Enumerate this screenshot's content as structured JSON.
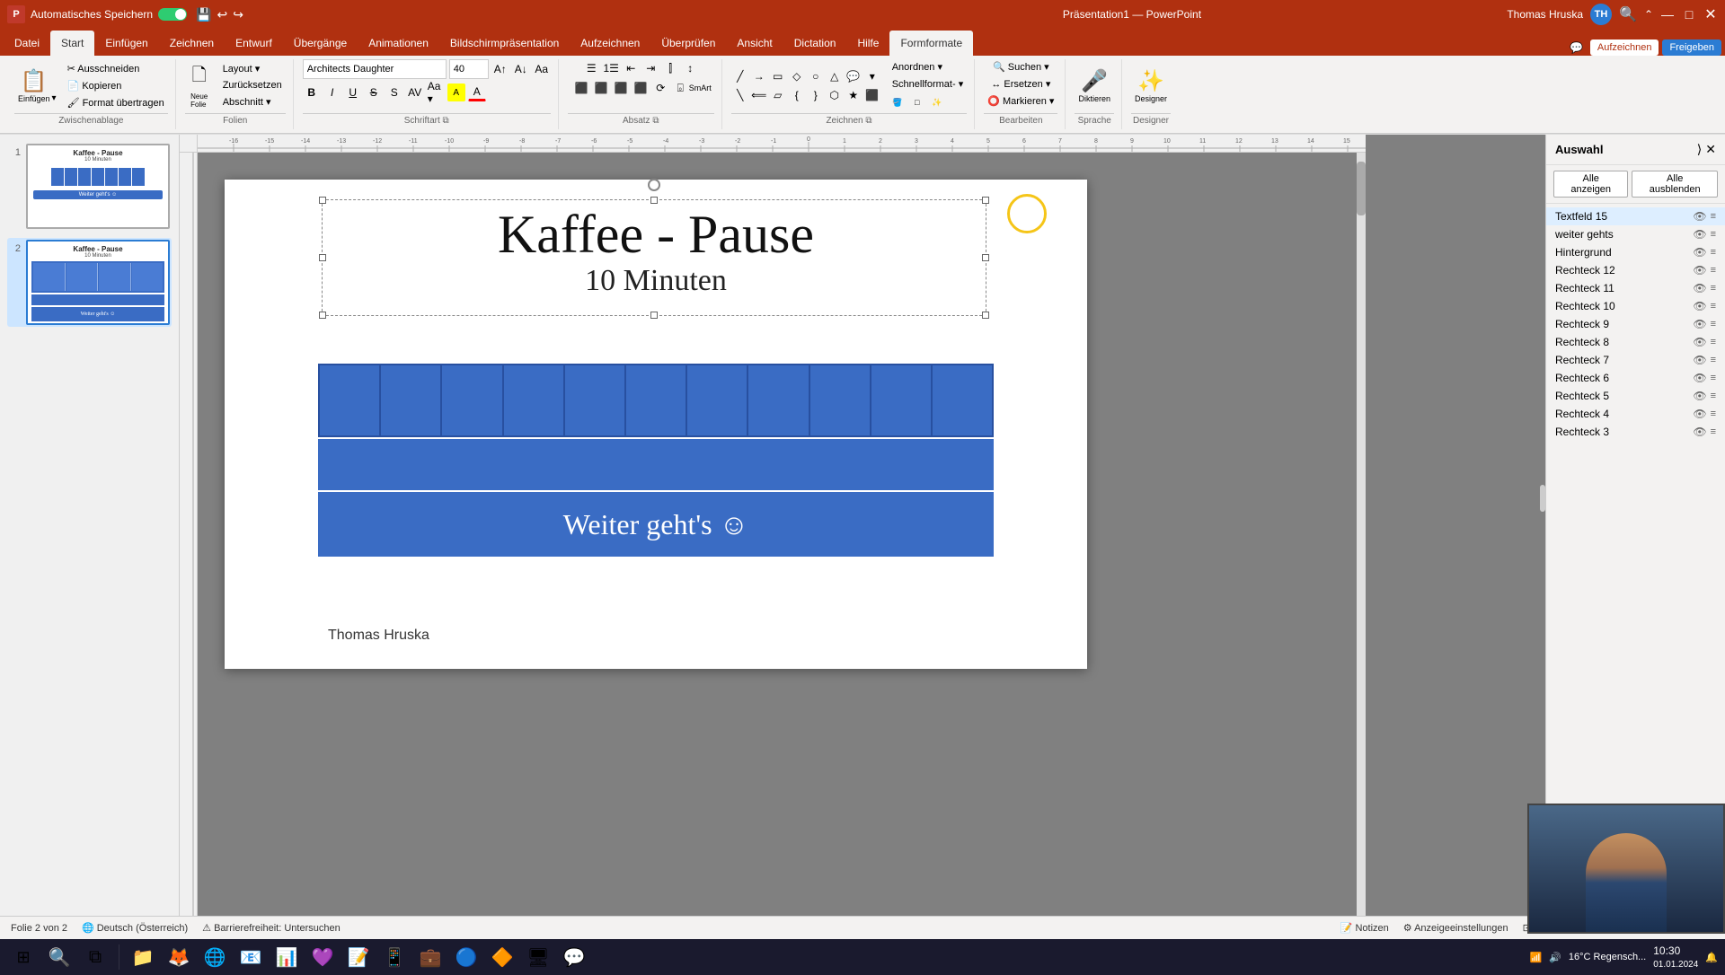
{
  "titleBar": {
    "autosave": "Automatisches Speichern",
    "filename": "Präsentation1",
    "app": "PowerPoint",
    "user": "Thomas Hruska",
    "initials": "TH"
  },
  "ribbonTabs": [
    {
      "label": "Datei",
      "active": false
    },
    {
      "label": "Start",
      "active": true
    },
    {
      "label": "Einfügen",
      "active": false
    },
    {
      "label": "Zeichnen",
      "active": false
    },
    {
      "label": "Entwurf",
      "active": false
    },
    {
      "label": "Übergänge",
      "active": false
    },
    {
      "label": "Animationen",
      "active": false
    },
    {
      "label": "Bildschirmpräsentation",
      "active": false
    },
    {
      "label": "Aufzeichnen",
      "active": false
    },
    {
      "label": "Überprüfen",
      "active": false
    },
    {
      "label": "Ansicht",
      "active": false
    },
    {
      "label": "Dictation",
      "active": false
    },
    {
      "label": "Hilfe",
      "active": false
    },
    {
      "label": "Formformate",
      "active": true,
      "highlighted": true
    }
  ],
  "toolbar": {
    "fontName": "Architects Daughter",
    "fontSize": "40",
    "groups": {
      "clipboard": "Zwischenablage",
      "slides": "Folien",
      "font": "Schriftart",
      "paragraph": "Absatz",
      "drawing": "Zeichnen",
      "editing": "Bearbeiten",
      "voice": "Sprache",
      "designer": "Designer"
    },
    "buttons": {
      "ausschneiden": "Ausschneiden",
      "kopieren": "Kopieren",
      "einfuegen": "Einfügen",
      "zurücksetzen": "Zurücksetzen",
      "formatPinsel": "Format übertragen",
      "neuefolie": "Neue Folie",
      "layout": "Layout",
      "abschnitt": "Abschnitt",
      "diktieren": "Diktieren",
      "designer": "Designer",
      "anordnen": "Anordnen",
      "schnellformatvorlagen": "Schnellformat-vorlagen",
      "suchen": "Suchen",
      "ersetzen": "Ersetzen",
      "markieren": "Markieren",
      "formeffekt": "Formeffekt",
      "formkontur": "Formkontur",
      "formfuellung": "Füleffekt"
    }
  },
  "slides": [
    {
      "num": 1,
      "title": "Kaffee - Pause",
      "subtitle": "10 Minuten",
      "active": false
    },
    {
      "num": 2,
      "title": "Kaffee - Pause",
      "subtitle": "10 Minuten",
      "active": true
    }
  ],
  "slide": {
    "mainTitle": "Kaffee - Pause",
    "subtitle": "10 Minuten",
    "buttonText": "Weiter geht's ☺",
    "author": "Thomas Hruska"
  },
  "rightPanel": {
    "title": "Auswahl",
    "showAll": "Alle anzeigen",
    "hideAll": "Alle ausblenden",
    "items": [
      {
        "name": "Textfeld 15",
        "visible": true
      },
      {
        "name": "weiter gehts",
        "visible": true
      },
      {
        "name": "Hintergrund",
        "visible": true
      },
      {
        "name": "Rechteck 12",
        "visible": true
      },
      {
        "name": "Rechteck 11",
        "visible": true
      },
      {
        "name": "Rechteck 10",
        "visible": true
      },
      {
        "name": "Rechteck 9",
        "visible": true
      },
      {
        "name": "Rechteck 8",
        "visible": true
      },
      {
        "name": "Rechteck 7",
        "visible": true
      },
      {
        "name": "Rechteck 6",
        "visible": true
      },
      {
        "name": "Rechteck 5",
        "visible": true
      },
      {
        "name": "Rechteck 4",
        "visible": true
      },
      {
        "name": "Rechteck 3",
        "visible": true
      }
    ]
  },
  "statusBar": {
    "slideInfo": "Folie 2 von 2",
    "language": "Deutsch (Österreich)",
    "accessibility": "Barrierefreiheit: Untersuchen",
    "notes": "Notizen",
    "viewSettings": "Anzeigeeinstellungen",
    "zoomLevel": "16°C  Regensch..."
  },
  "taskbar": {
    "time": "16°C  Regensch...",
    "items": [
      "⊞",
      "📁",
      "🦊",
      "🌐",
      "📧",
      "🎯",
      "📷",
      "🎵",
      "📱",
      "💼",
      "📝",
      "📊",
      "🔵",
      "🔶",
      "📞",
      "🖥️",
      "💬"
    ]
  }
}
